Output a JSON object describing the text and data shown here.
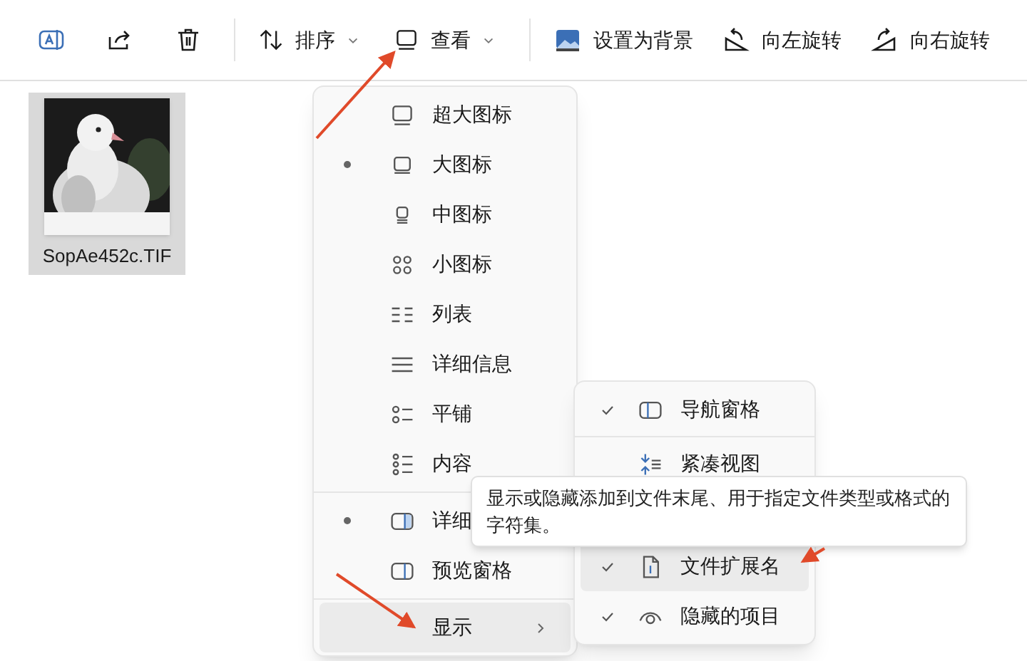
{
  "toolbar": [
    {
      "kind": "ocr"
    },
    {
      "kind": "share"
    },
    {
      "kind": "delete"
    },
    {
      "kind": "separator"
    },
    {
      "kind": "sort",
      "label": "排序",
      "dropdown": true
    },
    {
      "kind": "view",
      "label": "查看",
      "dropdown": true
    },
    {
      "kind": "separator"
    },
    {
      "kind": "wallpaper",
      "label": "设置为背景",
      "dropdown": false
    },
    {
      "kind": "rotate-left",
      "label": "向左旋转",
      "dropdown": false
    },
    {
      "kind": "rotate-right",
      "label": "向右旋转",
      "dropdown": false
    }
  ],
  "file": {
    "name": "SopAe452c.TIF",
    "selected": true,
    "kind": "picture"
  },
  "view_menu": {
    "groups": [
      {
        "items": [
          {
            "kind": "extra-large",
            "label": "超大图标",
            "selected": false
          },
          {
            "kind": "large",
            "label": "大图标",
            "selected": true
          },
          {
            "kind": "medium",
            "label": "中图标",
            "selected": false
          },
          {
            "kind": "small",
            "label": "小图标",
            "selected": false
          },
          {
            "kind": "list",
            "label": "列表",
            "selected": false
          },
          {
            "kind": "details",
            "label": "详细信息",
            "selected": false
          },
          {
            "kind": "tiles",
            "label": "平铺",
            "selected": false
          },
          {
            "kind": "content",
            "label": "内容",
            "selected": false
          }
        ]
      },
      {
        "items": [
          {
            "kind": "details-pane",
            "label": "详细",
            "selected": true
          },
          {
            "kind": "preview-pane",
            "label": "预览窗格",
            "selected": false
          }
        ]
      },
      {
        "items": [
          {
            "kind": "show",
            "label": "显示",
            "selected": false,
            "expanded": true
          }
        ]
      }
    ]
  },
  "show_menu": {
    "items": [
      {
        "kind": "nav-pane",
        "label": "导航窗格",
        "checked": true,
        "hovered": false
      },
      {
        "kind": "compact",
        "label": "紧凑视图",
        "checked": false,
        "hovered": false
      },
      {
        "kind": "gap"
      },
      {
        "kind": "extensions",
        "label": "文件扩展名",
        "checked": true,
        "hovered": true
      },
      {
        "kind": "hidden-items",
        "label": "隐藏的项目",
        "checked": true,
        "hovered": false
      }
    ]
  },
  "tooltip": {
    "text": "显示或隐藏添加到文件末尾、用于指定文件类型或格式的字符集。"
  }
}
